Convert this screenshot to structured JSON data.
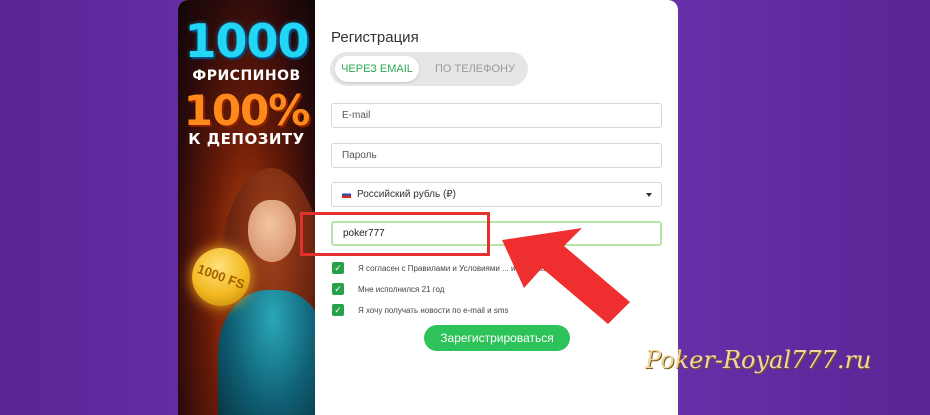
{
  "banner": {
    "line1": "1000",
    "line2": "ФРИСПИНОВ",
    "line3": "100%",
    "line4": "К ДЕПОЗИТУ",
    "coin_text": "1000 FS"
  },
  "form": {
    "title": "Регистрация",
    "tabs": [
      {
        "label": "ЧЕРЕЗ EMAIL",
        "active": true
      },
      {
        "label": "ПО ТЕЛЕФОНУ",
        "active": false
      }
    ],
    "email_placeholder": "E-mail",
    "password_placeholder": "Пароль",
    "currency_value": "Российский рубль (₽)",
    "promo_value": "poker777",
    "checkboxes": [
      {
        "label": "Я согласен с Правилами и Условиями ... информация",
        "checked": true
      },
      {
        "label": "Мне исполнился 21 год",
        "checked": true
      },
      {
        "label": "Я хочу получать новости по e-mail и sms",
        "checked": true
      }
    ],
    "submit_label": "Зарегистрироваться"
  },
  "watermark": "Poker-Royal777.ru",
  "colors": {
    "accent_green": "#2dc25a",
    "highlight_red": "#e53030",
    "background_purple": "#6d34b0"
  }
}
